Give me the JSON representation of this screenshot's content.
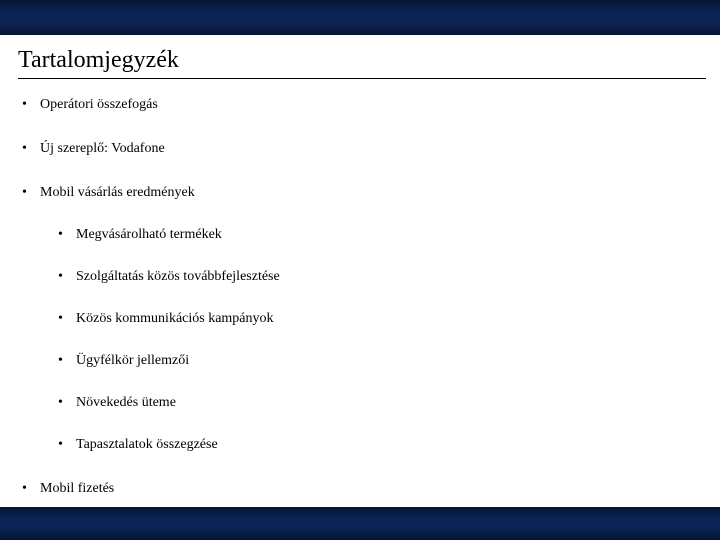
{
  "title": "Tartalomjegyzék",
  "items": [
    {
      "label": "Operátori összefogás"
    },
    {
      "label": "Új szereplő: Vodafone"
    },
    {
      "label": "Mobil vásárlás eredmények",
      "sub": [
        {
          "label": "Megvásárolható termékek"
        },
        {
          "label": "Szolgáltatás közös továbbfejlesztése"
        },
        {
          "label": "Közös kommunikációs kampányok"
        },
        {
          "label": "Ügyfélkör jellemzői"
        },
        {
          "label": "Növekedés üteme"
        },
        {
          "label": "Tapasztalatok összegzése"
        }
      ]
    },
    {
      "label": "Mobil fizetés"
    }
  ]
}
